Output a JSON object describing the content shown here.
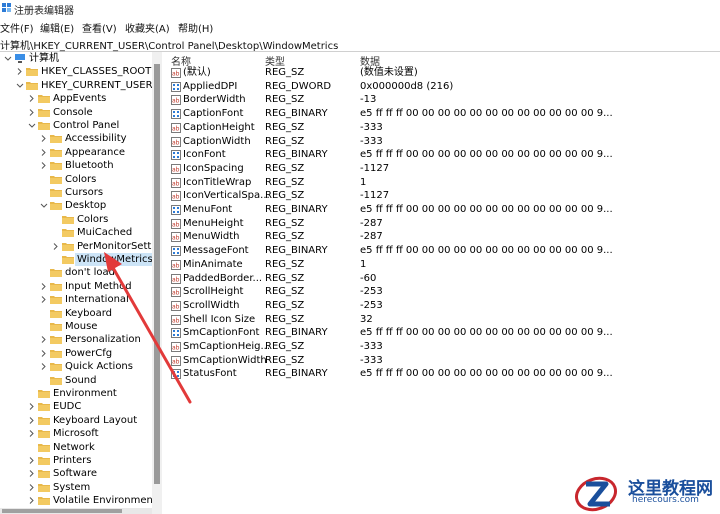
{
  "window": {
    "title": "注册表编辑器"
  },
  "menu": [
    "文件(F)",
    "编辑(E)",
    "查看(V)",
    "收藏夹(A)",
    "帮助(H)"
  ],
  "address": "计算机\\HKEY_CURRENT_USER\\Control Panel\\Desktop\\WindowMetrics",
  "tree": [
    {
      "label": "计算机",
      "level": 0,
      "expanded": true,
      "icon": "computer-icon"
    },
    {
      "label": "HKEY_CLASSES_ROOT",
      "level": 1,
      "expanded": false
    },
    {
      "label": "HKEY_CURRENT_USER",
      "level": 1,
      "expanded": true
    },
    {
      "label": "AppEvents",
      "level": 2,
      "expanded": false
    },
    {
      "label": "Console",
      "level": 2,
      "expanded": false
    },
    {
      "label": "Control Panel",
      "level": 2,
      "expanded": true
    },
    {
      "label": "Accessibility",
      "level": 3,
      "expanded": false
    },
    {
      "label": "Appearance",
      "level": 3,
      "expanded": false
    },
    {
      "label": "Bluetooth",
      "level": 3,
      "expanded": false
    },
    {
      "label": "Colors",
      "level": 3,
      "expanded": null
    },
    {
      "label": "Cursors",
      "level": 3,
      "expanded": null
    },
    {
      "label": "Desktop",
      "level": 3,
      "expanded": true
    },
    {
      "label": "Colors",
      "level": 4,
      "expanded": null
    },
    {
      "label": "MuiCached",
      "level": 4,
      "expanded": null
    },
    {
      "label": "PerMonitorSettings",
      "level": 4,
      "expanded": false
    },
    {
      "label": "WindowMetrics",
      "level": 4,
      "expanded": null,
      "selected": true
    },
    {
      "label": "don't load",
      "level": 3,
      "expanded": null
    },
    {
      "label": "Input Method",
      "level": 3,
      "expanded": false
    },
    {
      "label": "International",
      "level": 3,
      "expanded": false
    },
    {
      "label": "Keyboard",
      "level": 3,
      "expanded": null
    },
    {
      "label": "Mouse",
      "level": 3,
      "expanded": null
    },
    {
      "label": "Personalization",
      "level": 3,
      "expanded": false
    },
    {
      "label": "PowerCfg",
      "level": 3,
      "expanded": false
    },
    {
      "label": "Quick Actions",
      "level": 3,
      "expanded": false
    },
    {
      "label": "Sound",
      "level": 3,
      "expanded": null
    },
    {
      "label": "Environment",
      "level": 2,
      "expanded": null
    },
    {
      "label": "EUDC",
      "level": 2,
      "expanded": false
    },
    {
      "label": "Keyboard Layout",
      "level": 2,
      "expanded": false
    },
    {
      "label": "Microsoft",
      "level": 2,
      "expanded": false
    },
    {
      "label": "Network",
      "level": 2,
      "expanded": null
    },
    {
      "label": "Printers",
      "level": 2,
      "expanded": false
    },
    {
      "label": "Software",
      "level": 2,
      "expanded": false
    },
    {
      "label": "System",
      "level": 2,
      "expanded": false
    },
    {
      "label": "Volatile Environment",
      "level": 2,
      "expanded": false
    }
  ],
  "columns": {
    "name": "名称",
    "type": "类型",
    "data": "数据"
  },
  "values": [
    {
      "name": "(默认)",
      "type": "REG_SZ",
      "data": "(数值未设置)",
      "kind": "string"
    },
    {
      "name": "AppliedDPI",
      "type": "REG_DWORD",
      "data": "0x000000d8 (216)",
      "kind": "binary"
    },
    {
      "name": "BorderWidth",
      "type": "REG_SZ",
      "data": "-13",
      "kind": "string"
    },
    {
      "name": "CaptionFont",
      "type": "REG_BINARY",
      "data": "e5 ff ff ff 00 00 00 00 00 00 00 00 00 00 00 00 9...",
      "kind": "binary"
    },
    {
      "name": "CaptionHeight",
      "type": "REG_SZ",
      "data": "-333",
      "kind": "string"
    },
    {
      "name": "CaptionWidth",
      "type": "REG_SZ",
      "data": "-333",
      "kind": "string"
    },
    {
      "name": "IconFont",
      "type": "REG_BINARY",
      "data": "e5 ff ff ff 00 00 00 00 00 00 00 00 00 00 00 00 9...",
      "kind": "binary"
    },
    {
      "name": "IconSpacing",
      "type": "REG_SZ",
      "data": "-1127",
      "kind": "string"
    },
    {
      "name": "IconTitleWrap",
      "type": "REG_SZ",
      "data": "1",
      "kind": "string"
    },
    {
      "name": "IconVerticalSpa...",
      "type": "REG_SZ",
      "data": "-1127",
      "kind": "string"
    },
    {
      "name": "MenuFont",
      "type": "REG_BINARY",
      "data": "e5 ff ff ff 00 00 00 00 00 00 00 00 00 00 00 00 9...",
      "kind": "binary"
    },
    {
      "name": "MenuHeight",
      "type": "REG_SZ",
      "data": "-287",
      "kind": "string"
    },
    {
      "name": "MenuWidth",
      "type": "REG_SZ",
      "data": "-287",
      "kind": "string"
    },
    {
      "name": "MessageFont",
      "type": "REG_BINARY",
      "data": "e5 ff ff ff 00 00 00 00 00 00 00 00 00 00 00 00 9...",
      "kind": "binary"
    },
    {
      "name": "MinAnimate",
      "type": "REG_SZ",
      "data": "1",
      "kind": "string"
    },
    {
      "name": "PaddedBorder...",
      "type": "REG_SZ",
      "data": "-60",
      "kind": "string"
    },
    {
      "name": "ScrollHeight",
      "type": "REG_SZ",
      "data": "-253",
      "kind": "string"
    },
    {
      "name": "ScrollWidth",
      "type": "REG_SZ",
      "data": "-253",
      "kind": "string"
    },
    {
      "name": "Shell Icon Size",
      "type": "REG_SZ",
      "data": "32",
      "kind": "string"
    },
    {
      "name": "SmCaptionFont",
      "type": "REG_BINARY",
      "data": "e5 ff ff ff 00 00 00 00 00 00 00 00 00 00 00 00 9...",
      "kind": "binary"
    },
    {
      "name": "SmCaptionHeig...",
      "type": "REG_SZ",
      "data": "-333",
      "kind": "string"
    },
    {
      "name": "SmCaptionWidth",
      "type": "REG_SZ",
      "data": "-333",
      "kind": "string"
    },
    {
      "name": "StatusFont",
      "type": "REG_BINARY",
      "data": "e5 ff ff ff 00 00 00 00 00 00 00 00 00 00 00 00 9...",
      "kind": "binary"
    }
  ],
  "watermark": {
    "title": "这里教程网",
    "url": "herecours.com"
  },
  "colors": {
    "folder": "#e8b84a",
    "selection": "#cce4f7",
    "arrow": "#e23a3a",
    "brand": "#1a4f9c"
  }
}
